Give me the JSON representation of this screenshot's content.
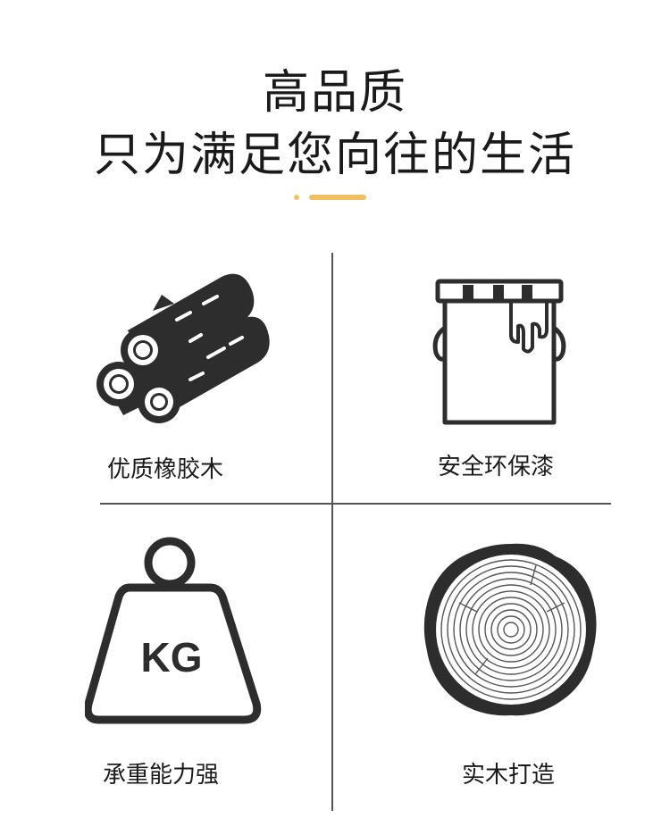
{
  "header": {
    "line1": "高品质",
    "line2": "只为满足您向往的生活"
  },
  "colors": {
    "accent": "#f0c060",
    "text": "#1a1a1a",
    "icon": "#2d2d2d",
    "divider": "#555555"
  },
  "features": [
    {
      "icon": "wood-logs-icon",
      "label": "优质橡胶木"
    },
    {
      "icon": "paint-bucket-icon",
      "label": "安全环保漆"
    },
    {
      "icon": "kg-weight-icon",
      "label": "承重能力强",
      "icon_text": "KG"
    },
    {
      "icon": "tree-ring-icon",
      "label": "实木打造"
    }
  ]
}
